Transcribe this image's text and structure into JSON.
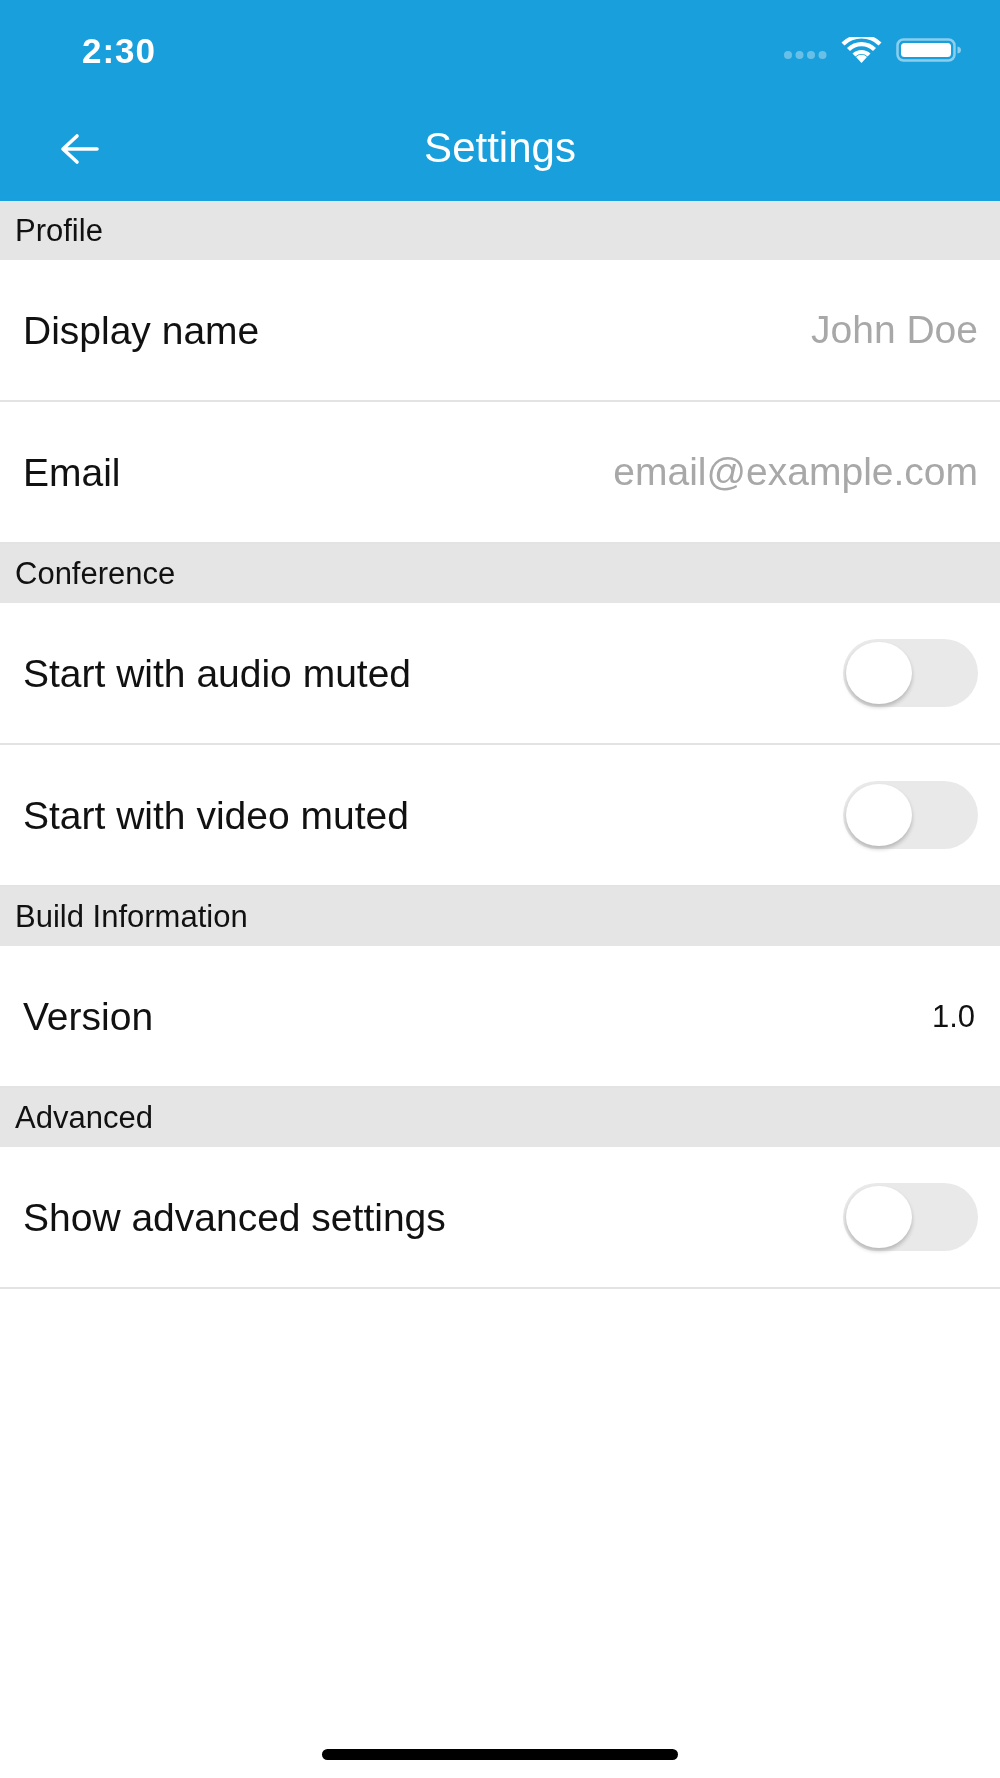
{
  "status_bar": {
    "time": "2:30"
  },
  "app_bar": {
    "title": "Settings"
  },
  "sections": [
    {
      "title": "Profile",
      "items": [
        {
          "kind": "field",
          "label": "Display name",
          "placeholder": "John Doe"
        },
        {
          "kind": "field",
          "label": "Email",
          "placeholder": "email@example.com"
        }
      ]
    },
    {
      "title": "Conference",
      "items": [
        {
          "kind": "switch",
          "label": "Start with audio muted",
          "on": false
        },
        {
          "kind": "switch",
          "label": "Start with video muted",
          "on": false
        }
      ]
    },
    {
      "title": "Build Information",
      "items": [
        {
          "kind": "value",
          "label": "Version",
          "value": "1.0"
        }
      ]
    },
    {
      "title": "Advanced",
      "items": [
        {
          "kind": "switch",
          "label": "Show advanced settings",
          "on": false
        }
      ]
    }
  ]
}
